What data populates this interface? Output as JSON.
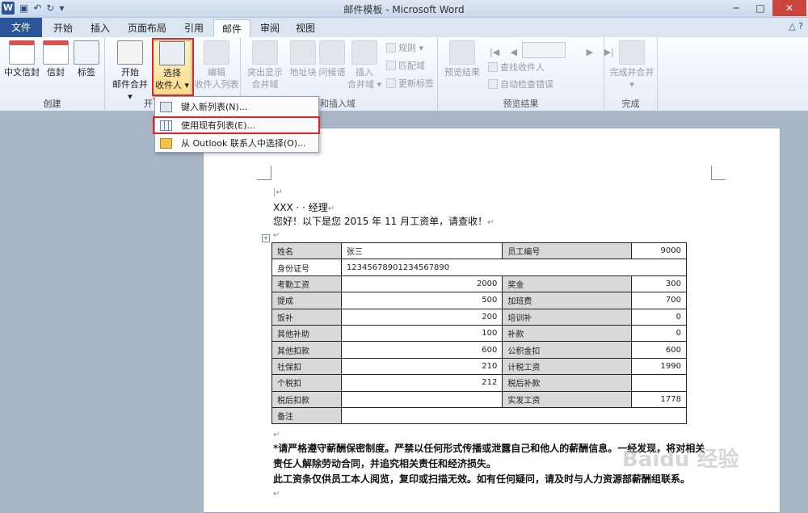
{
  "window": {
    "title": "邮件模板 - Microsoft Word",
    "app_icon": "W"
  },
  "tabs": [
    {
      "label": "文件"
    },
    {
      "label": "开始"
    },
    {
      "label": "插入"
    },
    {
      "label": "页面布局"
    },
    {
      "label": "引用"
    },
    {
      "label": "邮件"
    },
    {
      "label": "审阅"
    },
    {
      "label": "视图"
    }
  ],
  "ribbon": {
    "create": {
      "label": "创建",
      "cn_envelope": "中文信封",
      "envelope": "信封",
      "labels": "标签"
    },
    "start_merge": {
      "label": "开",
      "start": "开始",
      "start2": "邮件合并",
      "select": "选择",
      "select2": "收件人",
      "edit": "编辑",
      "edit2": "收件人列表"
    },
    "write_insert": {
      "label": "编写和插入域",
      "highlight": "突出显示",
      "highlight2": "合并域",
      "address": "地址块",
      "greeting": "问候语",
      "insert": "插入",
      "insert2": "合并域",
      "rules": "规则",
      "match": "匹配域",
      "update": "更新标签"
    },
    "preview": {
      "label": "预览结果",
      "preview_btn": "预览结果",
      "find": "查找收件人",
      "check": "自动检查错误"
    },
    "finish": {
      "label": "完成",
      "finish_btn": "完成并合并"
    }
  },
  "dropdown": {
    "type_new": "键入新列表(N)...",
    "use_existing": "使用现有列表(E)...",
    "outlook": "从 Outlook 联系人中选择(O)..."
  },
  "document": {
    "line1": "XXX · · 经理",
    "line2": "您好！以下是您 2015 年 11 月工资单，请查收！",
    "table": [
      [
        "姓名",
        "张三",
        "员工编号",
        "9000"
      ],
      [
        "身份证号",
        "12345678901234567890",
        "",
        ""
      ],
      [
        "考勤工资",
        "2000",
        "奖金",
        "300"
      ],
      [
        "提成",
        "500",
        "加班费",
        "700"
      ],
      [
        "饭补",
        "200",
        "培训补",
        "0"
      ],
      [
        "其他补助",
        "100",
        "补款",
        "0"
      ],
      [
        "其他扣款",
        "600",
        "公积金扣",
        "600"
      ],
      [
        "社保扣",
        "210",
        "计税工资",
        "1990"
      ],
      [
        "个税扣",
        "212",
        "税后补款",
        ""
      ],
      [
        "税后扣款",
        "",
        "实发工资",
        "1778"
      ],
      [
        "备注",
        "",
        "",
        ""
      ]
    ],
    "notice1": "*请严格遵守薪酬保密制度。严禁以任何形式传播或泄露自己和他人的薪酬信息。一经发现，将对相关",
    "notice2": "责任人解除劳动合同，并追究相关责任和经济损失。",
    "notice3": "此工资条仅供员工本人阅览，复印或扫描无效。如有任何疑问，请及时与人力资源部薪酬组联系。"
  },
  "watermark": "Baidu 经验"
}
